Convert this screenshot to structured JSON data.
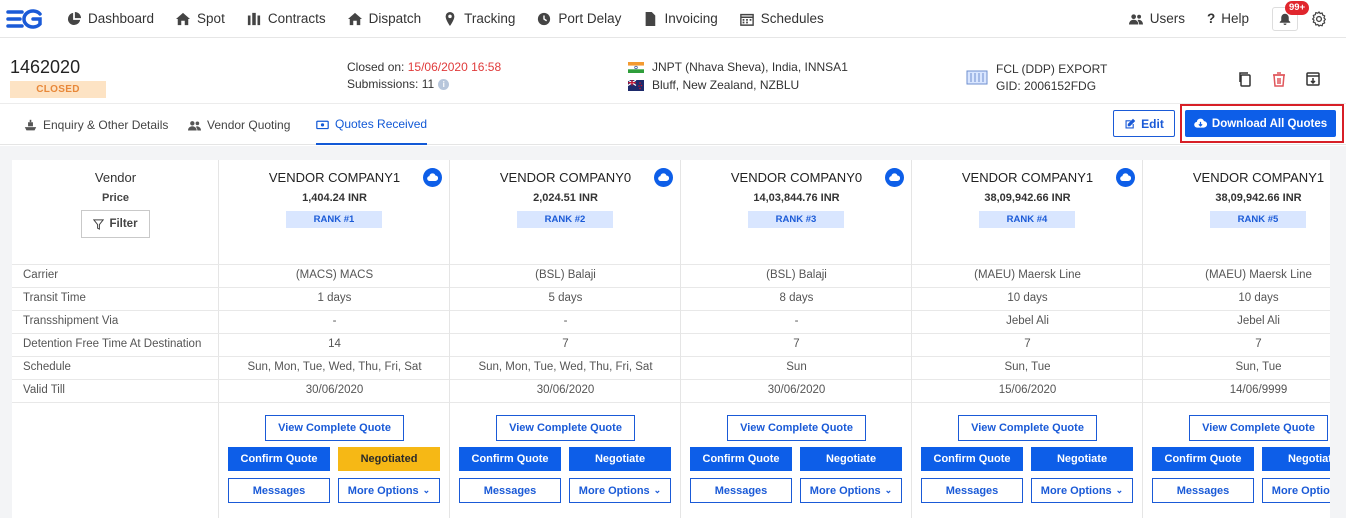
{
  "nav": {
    "items": [
      {
        "label": "Dashboard",
        "icon": "pie-chart-icon"
      },
      {
        "label": "Spot",
        "icon": "home-icon"
      },
      {
        "label": "Contracts",
        "icon": "contracts-icon"
      },
      {
        "label": "Dispatch",
        "icon": "dispatch-icon"
      },
      {
        "label": "Tracking",
        "icon": "map-pin-icon"
      },
      {
        "label": "Port Delay",
        "icon": "clock-icon"
      },
      {
        "label": "Invoicing",
        "icon": "document-icon"
      },
      {
        "label": "Schedules",
        "icon": "calendar-icon"
      }
    ],
    "users_label": "Users",
    "help_label": "Help",
    "notification_count": "99+"
  },
  "header": {
    "id": "1462020",
    "status": "CLOSED",
    "closed_on_label": "Closed on:",
    "closed_on_value": "15/06/2020 16:58",
    "submissions_label": "Submissions:",
    "submissions_value": "11",
    "origin": "JNPT (Nhava Sheva), India, INNSA1",
    "destination": "Bluff, New Zealand, NZBLU",
    "shipment_type": "FCL (DDP) EXPORT",
    "gid": "GID: 2006152FDG"
  },
  "tabs": [
    {
      "label": "Enquiry & Other Details"
    },
    {
      "label": "Vendor Quoting"
    },
    {
      "label": "Quotes Received"
    }
  ],
  "actions": {
    "edit_label": "Edit",
    "download_all_label": "Download All Quotes"
  },
  "table": {
    "vendor_header": "Vendor",
    "price_header": "Price",
    "filter_label": "Filter",
    "row_labels": [
      "Carrier",
      "Transit Time",
      "Transshipment Via",
      "Detention Free Time At Destination",
      "Schedule",
      "Valid Till"
    ],
    "view_quote_label": "View Complete Quote",
    "confirm_label": "Confirm Quote",
    "messages_label": "Messages",
    "more_options_label": "More Options",
    "vendors": [
      {
        "name": "VENDOR COMPANY1",
        "price": "1,404.24 INR",
        "rank": "RANK #1",
        "cells": [
          "(MACS) MACS",
          "1 days",
          "-",
          "14",
          "Sun, Mon, Tue, Wed, Thu, Fri, Sat",
          "30/06/2020"
        ],
        "negotiate_label": "Negotiated",
        "negotiated": true
      },
      {
        "name": "VENDOR COMPANY0",
        "price": "2,024.51 INR",
        "rank": "RANK #2",
        "cells": [
          "(BSL) Balaji",
          "5 days",
          "-",
          "7",
          "Sun, Mon, Tue, Wed, Thu, Fri, Sat",
          "30/06/2020"
        ],
        "negotiate_label": "Negotiate",
        "negotiated": false
      },
      {
        "name": "VENDOR COMPANY0",
        "price": "14,03,844.76 INR",
        "rank": "RANK #3",
        "cells": [
          "(BSL) Balaji",
          "8 days",
          "-",
          "7",
          "Sun",
          "30/06/2020"
        ],
        "negotiate_label": "Negotiate",
        "negotiated": false
      },
      {
        "name": "VENDOR COMPANY1",
        "price": "38,09,942.66 INR",
        "rank": "RANK #4",
        "cells": [
          "(MAEU) Maersk Line",
          "10 days",
          "Jebel Ali",
          "7",
          "Sun, Tue",
          "15/06/2020"
        ],
        "negotiate_label": "Negotiate",
        "negotiated": false
      },
      {
        "name": "VENDOR COMPANY1",
        "price": "38,09,942.66 INR",
        "rank": "RANK #5",
        "cells": [
          "(MAEU) Maersk Line",
          "10 days",
          "Jebel Ali",
          "7",
          "Sun, Tue",
          "14/06/9999"
        ],
        "negotiate_label": "Negotiate",
        "negotiated": false
      }
    ]
  },
  "colors": {
    "primary": "#0d5ee8",
    "negotiated": "#f6b815",
    "closed_badge_bg": "#fde3c4",
    "closed_text": "#e8883a",
    "highlight": "#d71f27"
  }
}
